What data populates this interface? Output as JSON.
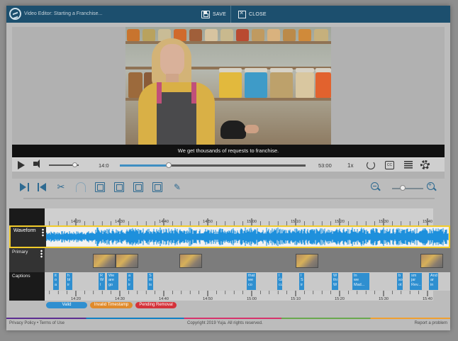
{
  "header": {
    "title": "Video Editor: Starting a Franchise...",
    "save_label": "SAVE",
    "close_label": "CLOSE",
    "bg_color": "#1c4f6e"
  },
  "video": {
    "subtitle": "We get thousands of requests to franchise.",
    "current_time": "14:0",
    "duration": "53:00",
    "speed": "1x",
    "cc_label": "CC",
    "progress_fraction": 0.265,
    "volume_fraction": 0.85
  },
  "tools": {
    "icons": [
      "skip-start-icon",
      "skip-back-icon",
      "scissors-icon",
      "undo-icon",
      "add-caption-icon",
      "insert-clip-icon",
      "split-icon",
      "text-icon",
      "pencil-icon"
    ],
    "zoom_fraction": 0.35
  },
  "timeline": {
    "ruler_labels": [
      "14:20",
      "14:30",
      "14:40",
      "14:50",
      "15:00",
      "15:10",
      "15:20",
      "15:30",
      "15:40"
    ],
    "waveform_label": "Waveform",
    "primary_label": "Primary",
    "captions_label": "Captions",
    "waveform_color": "#1e90dc",
    "highlight_color": "#f1cb2a",
    "captions": [
      {
        "lines": [
          "it",
          "o",
          "a"
        ]
      },
      {
        "lines": [
          "h",
          "bl",
          "ir"
        ]
      },
      {
        "lines": [
          "R",
          "W",
          "I"
        ]
      },
      {
        "lines": [
          "We",
          "are",
          "go"
        ]
      },
      {
        "lines": [
          "a",
          "c",
          "ir"
        ]
      },
      {
        "lines": [
          "S",
          "th",
          "is"
        ]
      },
      {
        "lines": [
          "that",
          "we",
          "co"
        ]
      },
      {
        "lines": [
          "I",
          "Gi",
          "cu"
        ]
      },
      {
        "lines": [
          "I",
          "S",
          "ir"
        ]
      },
      {
        "lines": [
          "W",
          "thi",
          "W"
        ]
      },
      {
        "lines": [
          "In",
          "we",
          "Mad..."
        ]
      },
      {
        "lines": [
          "b",
          "so",
          "ot"
        ]
      },
      {
        "lines": [
          "sm",
          "jar",
          "Rev..."
        ]
      },
      {
        "lines": [
          "And",
          "ar",
          "in"
        ]
      }
    ]
  },
  "legend": {
    "valid": "Valid",
    "invalid": "Invalid Timestamp",
    "pending": "Pending Removal",
    "valid_color": "#2f8fd0",
    "invalid_color": "#e08a2a",
    "pending_color": "#d4323a"
  },
  "footer": {
    "privacy": "Privacy Policy",
    "terms": "Terms of Use",
    "copyright": "Copyright 2019 Yuja. All rights reserved.",
    "report": "Report a problem"
  }
}
